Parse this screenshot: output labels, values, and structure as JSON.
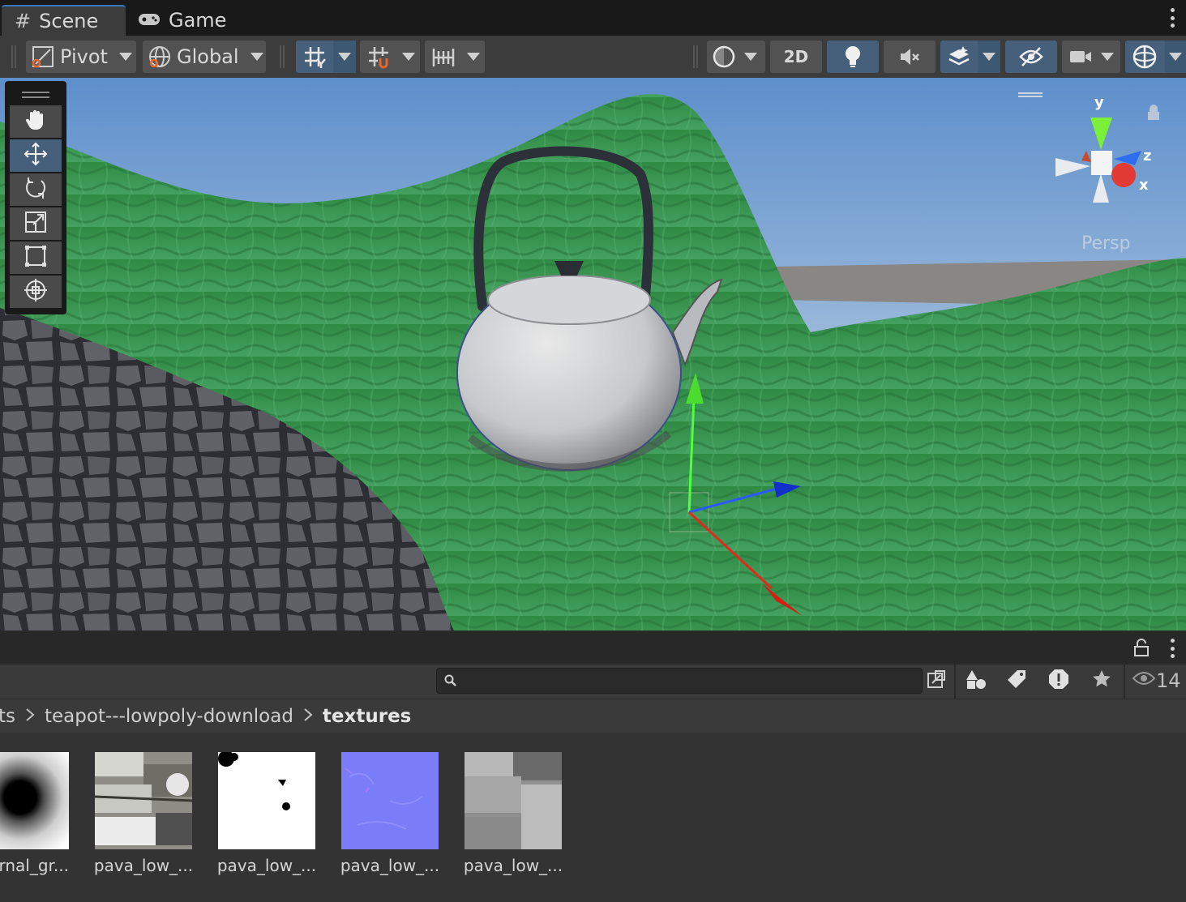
{
  "tabs": [
    {
      "label": "Scene",
      "icon": "hash-icon",
      "active": true
    },
    {
      "label": "Game",
      "icon": "gamepad-icon",
      "active": false
    }
  ],
  "toolbar": {
    "pivot_label": "Pivot",
    "global_label": "Global",
    "mode_2d_label": "2D"
  },
  "scene": {
    "persp_label": "Persp",
    "gizmo_axes": {
      "y": "y",
      "z": "z",
      "x": "x"
    },
    "tools": [
      "hand-icon",
      "move-icon",
      "rotate-icon",
      "scale-icon",
      "rect-icon",
      "transform-icon"
    ],
    "active_tool": "move-icon"
  },
  "project": {
    "search_placeholder": "",
    "visibility_count": "14",
    "breadcrumb": [
      {
        "label": "ts"
      },
      {
        "label": "teapot---lowpoly-download"
      },
      {
        "label": "textures"
      }
    ],
    "assets": [
      {
        "label": "rnal_gr...",
        "kind": "radial-gradient"
      },
      {
        "label": "pava_low_...",
        "kind": "diffuse"
      },
      {
        "label": "pava_low_...",
        "kind": "mask"
      },
      {
        "label": "pava_low_...",
        "kind": "normal"
      },
      {
        "label": "pava_low_...",
        "kind": "roughness"
      }
    ]
  },
  "colors": {
    "accent": "#3a79bb",
    "active_button": "#46607c",
    "grass": "#3f9a55",
    "sky": "#7da7d6"
  }
}
